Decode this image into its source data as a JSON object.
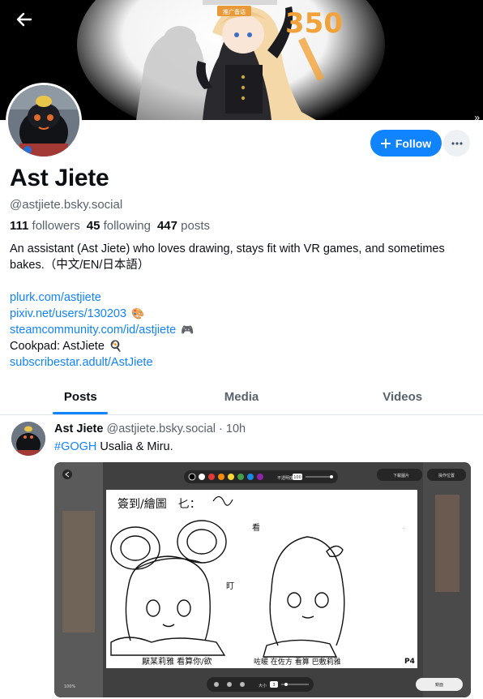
{
  "banner": {
    "back_icon": "arrow-left-icon",
    "corner_glyph": "»",
    "badge_text": "推广备话",
    "sign_text": "350"
  },
  "profile": {
    "display_name": "Ast Jiete",
    "handle": "@astjiete.bsky.social",
    "followers_count": "111",
    "followers_label": "followers",
    "following_count": "45",
    "following_label": "following",
    "posts_count": "447",
    "posts_label": "posts",
    "bio": "An assistant (Ast Jiete) who loves drawing, stays fit with VR games, and sometimes bakes.（中文/EN/日本語）",
    "links": [
      {
        "text": "plurk.com/astjiete",
        "emoji": ""
      },
      {
        "text": "pixiv.net/users/130203",
        "emoji": "🎨"
      },
      {
        "text": "steamcommunity.com/id/astjiete",
        "emoji": "🎮"
      },
      {
        "text": "Cookpad: AstJiete",
        "emoji": "🍳"
      },
      {
        "text": "subscribestar.adult/AstJiete",
        "emoji": ""
      }
    ]
  },
  "actions": {
    "follow_label": "Follow",
    "follow_icon": "plus-icon",
    "more_icon": "ellipsis-icon"
  },
  "tabs": [
    "Posts",
    "Media",
    "Videos"
  ],
  "active_tab": "Posts",
  "post": {
    "author_name": "Ast Jiete",
    "author_handle": "@astjiete.bsky.social",
    "separator": "·",
    "time": "10h",
    "hashtag": "#GOGH",
    "text": " Usalia & Miru.",
    "image": {
      "toolbar_left": "不透明度",
      "toolbar_value": "100",
      "top_right_1": "下載圖片",
      "top_right_2": "操作位置",
      "sketch_title": "簽到/繪圖　𠤎：",
      "bottom_left": "100%",
      "bottom_right": "鏡面",
      "size_label": "大小",
      "size_value": "3",
      "label_1": "厭某莉雅 看算你/欲",
      "label_2": "咗暖 在佐方 看算 巴敷莉雅",
      "label_3": "看",
      "label_4": "盯",
      "page_no": "P4"
    }
  },
  "colors": {
    "accent": "#1083fe",
    "text": "#0b0f14",
    "muted": "#58616c",
    "divider": "#e0e5ea"
  }
}
